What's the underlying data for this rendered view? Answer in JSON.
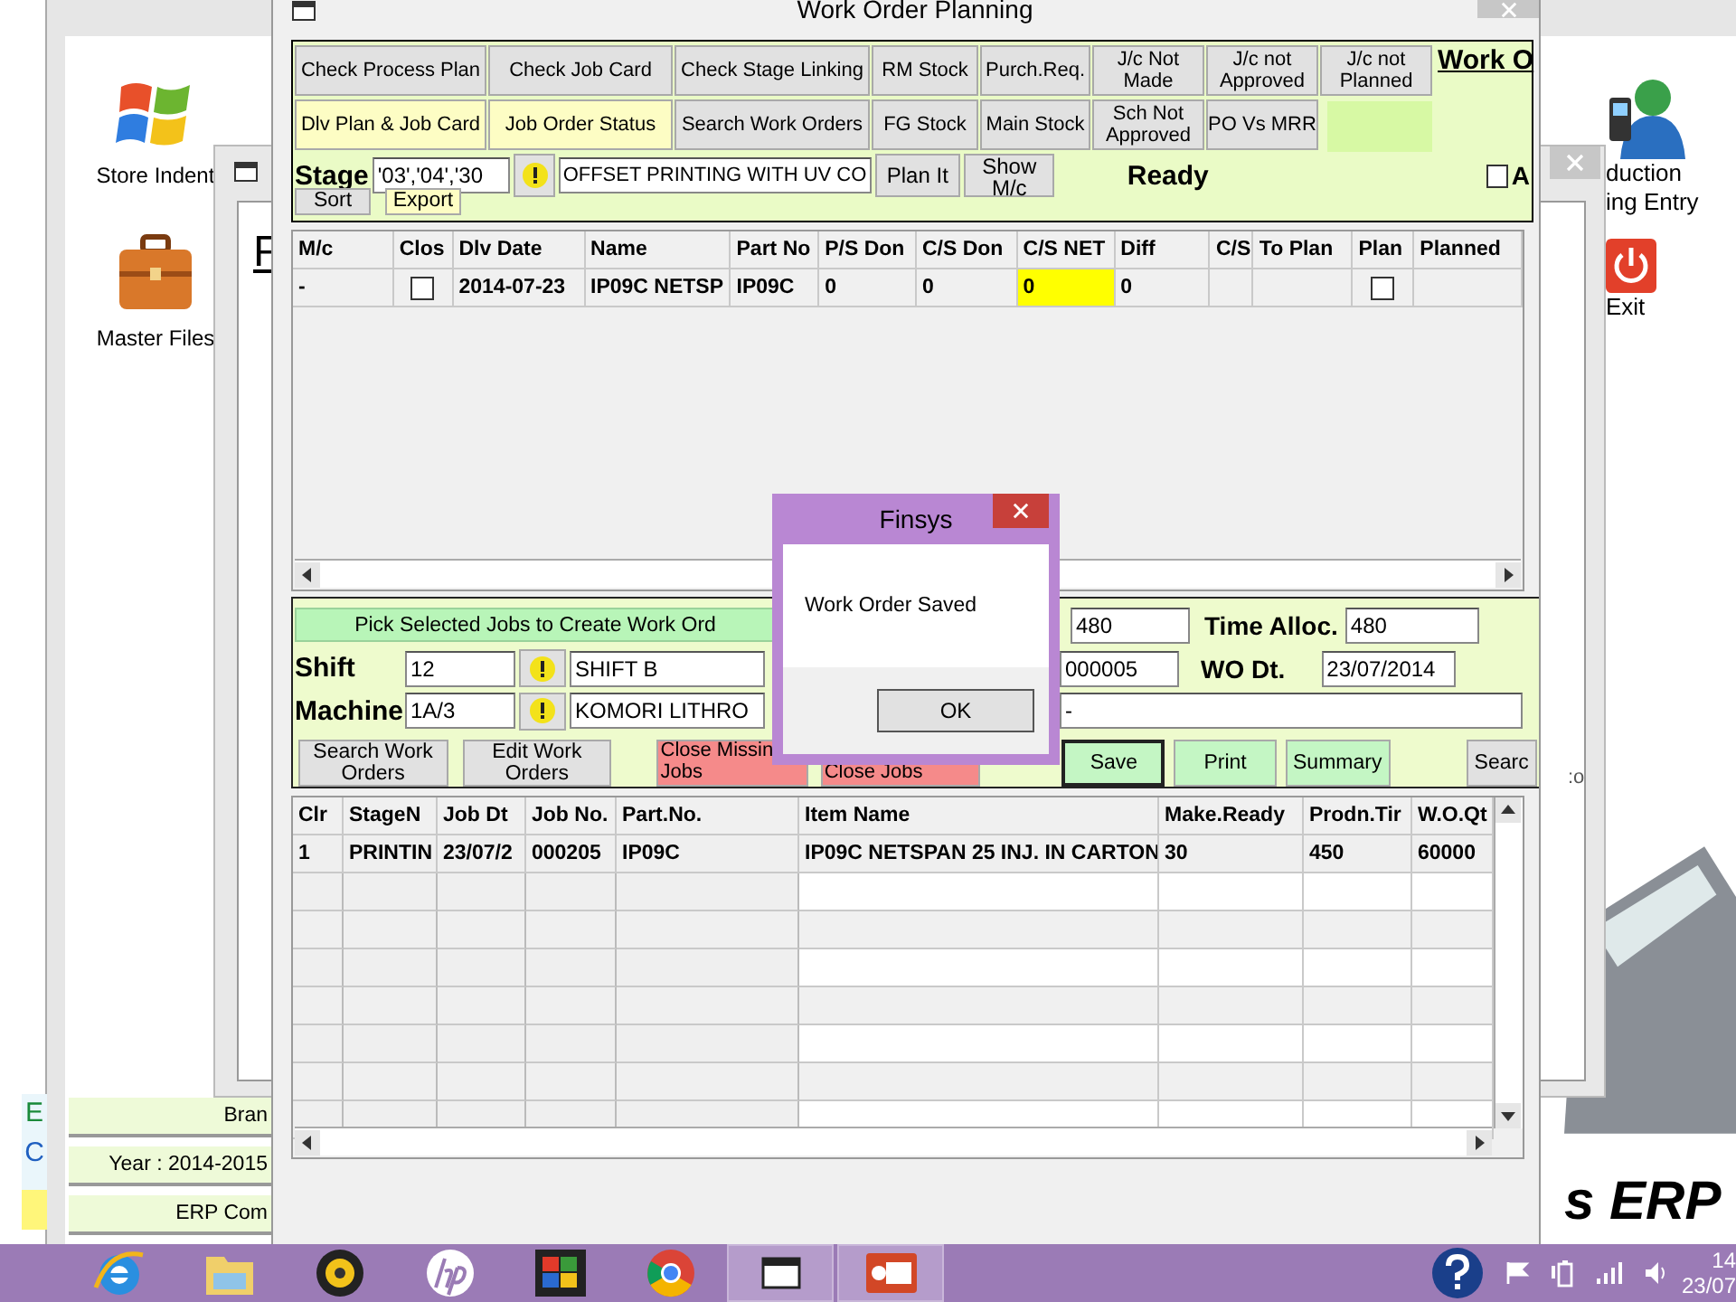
{
  "desktop": {
    "left_icons": [
      {
        "label": "Store Indent",
        "kind": "windows"
      },
      {
        "label": "Master Files",
        "kind": "briefcase"
      }
    ],
    "right_icons": [
      {
        "lines": [
          "duction",
          "ing Entry"
        ],
        "kind": "person"
      },
      {
        "lines": [
          "Exit"
        ],
        "kind": "power"
      }
    ],
    "side_letters": [
      {
        "text": "E",
        "color": "#1a8a3a"
      },
      {
        "text": "C",
        "color": "#1f5fc0"
      }
    ],
    "status_items": [
      "Bran",
      "Year : 2014-2015",
      "ERP Com"
    ],
    "logo_text": "s ERP",
    "stray_text": ":o"
  },
  "back_window": {
    "heading": "F"
  },
  "window": {
    "title": "Work Order Planning",
    "toolbar_rows": [
      [
        {
          "label": "Check Process Plan",
          "kind": "plain"
        },
        {
          "label": "Check Job Card",
          "kind": "plain"
        },
        {
          "label": "Check Stage Linking",
          "kind": "plain"
        },
        {
          "label": "RM Stock",
          "kind": "plain"
        },
        {
          "label": "Purch.Req.",
          "kind": "plain"
        },
        {
          "label": "J/c Not Made",
          "kind": "plain"
        },
        {
          "label": "J/c not Approved",
          "kind": "plain"
        },
        {
          "label": "J/c not Planned",
          "kind": "plain"
        }
      ],
      [
        {
          "label": "Dlv Plan & Job Card",
          "kind": "yellow"
        },
        {
          "label": "Job Order Status",
          "kind": "yellow"
        },
        {
          "label": "Search Work Orders",
          "kind": "plain"
        },
        {
          "label": "FG Stock",
          "kind": "plain"
        },
        {
          "label": "Main Stock",
          "kind": "plain"
        },
        {
          "label": "Sch Not Approved",
          "kind": "plain"
        },
        {
          "label": "PO Vs MRR",
          "kind": "plain"
        }
      ]
    ],
    "heading": "Work O",
    "stage": {
      "label": "Stage",
      "code": "'03','04','30",
      "description": "OFFSET PRINTING WITH UV CO"
    },
    "stage_buttons": [
      "Plan It",
      "Show M/c"
    ],
    "status": "Ready",
    "option": {
      "label": "A",
      "checked": false
    },
    "small_buttons": [
      {
        "label": "Sort",
        "kind": "plain"
      },
      {
        "label": "Export",
        "kind": "yellow"
      }
    ],
    "plan_grid": {
      "columns": [
        "M/c",
        "Clos",
        "Dlv Date",
        "Name",
        "Part No",
        "P/S Don",
        "C/S Don",
        "C/S NET",
        "Diff",
        "C/S",
        "To Plan",
        "Plan",
        "Planned"
      ],
      "rows": [
        [
          {
            "kind": "text",
            "text": "-",
            "highlighted": false
          },
          {
            "kind": "check",
            "checked": false
          },
          {
            "kind": "text",
            "text": "2014-07-23",
            "highlighted": false
          },
          {
            "kind": "text",
            "text": "IP09C NETSP",
            "highlighted": false
          },
          {
            "kind": "text",
            "text": "IP09C",
            "highlighted": false
          },
          {
            "kind": "text",
            "text": "0",
            "highlighted": false
          },
          {
            "kind": "text",
            "text": "0",
            "highlighted": false
          },
          {
            "kind": "text",
            "text": "0",
            "highlighted": true
          },
          {
            "kind": "text",
            "text": "0",
            "highlighted": false
          },
          {
            "kind": "blank"
          },
          {
            "kind": "blank"
          },
          {
            "kind": "check",
            "checked": false
          },
          {
            "kind": "blank"
          }
        ]
      ]
    },
    "pick_button": "Pick Selected Jobs to Create  Work Ord",
    "shift": {
      "label": "Shift",
      "code": "12",
      "name": "SHIFT B"
    },
    "machine": {
      "label": "Machine",
      "code": "1A/3",
      "name": "KOMORI LITHRO"
    },
    "time_field": "480",
    "time_alloc": {
      "label": "Time Alloc.",
      "value": "480"
    },
    "wo_no": "000005",
    "wo_date": {
      "label": "WO Dt.",
      "value": "23/07/2014"
    },
    "remark": "-",
    "action_buttons": [
      {
        "label": "Search Work Orders",
        "kind": "plain",
        "default": false
      },
      {
        "label": "Edit Work Orders",
        "kind": "plain",
        "default": false
      },
      {
        "label": "Close Missin Jobs",
        "kind": "red",
        "default": false
      },
      {
        "label": "Close Jobs",
        "kind": "red",
        "default": false
      },
      {
        "label": "Save",
        "kind": "green",
        "default": true
      },
      {
        "label": "Print",
        "kind": "green",
        "default": false
      },
      {
        "label": "Summary",
        "kind": "green",
        "default": false
      },
      {
        "label": "Searc",
        "kind": "plain",
        "default": false
      }
    ],
    "order_grid": {
      "columns": [
        "Clr",
        "StageN",
        "Job Dt",
        "Job No.",
        "Part.No.",
        "Item Name",
        "Make.Ready",
        "Prodn.Tir",
        "W.O.Qt"
      ],
      "rows": [
        [
          "1",
          "PRINTIN",
          "23/07/2",
          "000205",
          "IP09C",
          "IP09C NETSPAN 25 INJ. IN CARTON",
          "30",
          "450",
          "60000"
        ]
      ]
    }
  },
  "dialog": {
    "title": "Finsys",
    "message": "Work Order Saved",
    "button": "OK"
  },
  "taskbar": {
    "apps": [
      {
        "kind": "ie",
        "selected": false
      },
      {
        "kind": "folder",
        "selected": false
      },
      {
        "kind": "webcam",
        "selected": false
      },
      {
        "kind": "hp",
        "selected": false
      },
      {
        "kind": "puzzle",
        "selected": false
      },
      {
        "kind": "chrome",
        "selected": false
      },
      {
        "kind": "window",
        "selected": true
      },
      {
        "kind": "slides",
        "selected": true
      }
    ],
    "clock": [
      "14",
      "23/07"
    ]
  }
}
